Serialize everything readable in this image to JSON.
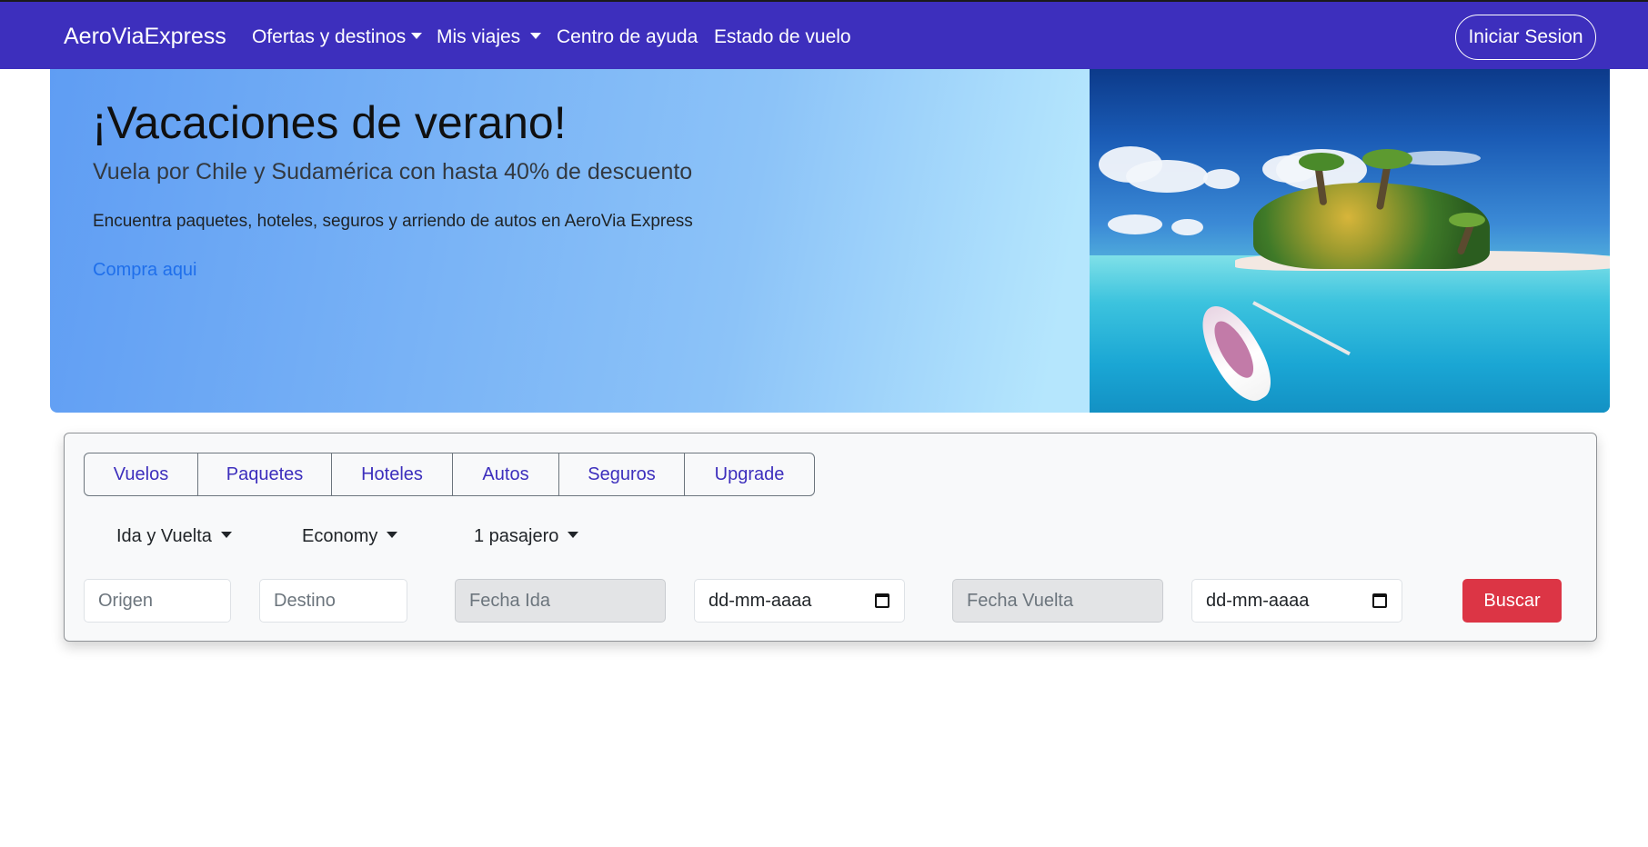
{
  "navbar": {
    "brand": "AeroViaExpress",
    "items": [
      {
        "label": "Ofertas y destinos",
        "dropdown": true
      },
      {
        "label": "Mis viajes",
        "dropdown": true
      },
      {
        "label": "Centro de ayuda",
        "dropdown": false
      },
      {
        "label": "Estado de vuelo",
        "dropdown": false
      }
    ],
    "login_label": "Iniciar Sesion",
    "background_color": "#3d2fbd"
  },
  "hero": {
    "title": "¡Vacaciones de verano!",
    "subtitle": "Vuela por Chile y Sudamérica con hasta 40% de descuento",
    "text": "Encuentra paquetes, hoteles, seguros y arriendo de autos en AeroVia Express",
    "link": "Compra aqui",
    "image": "tropical-island-beach-image"
  },
  "search": {
    "tabs": [
      "Vuelos",
      "Paquetes",
      "Hoteles",
      "Autos",
      "Seguros",
      "Upgrade"
    ],
    "trip_type": "Ida y Vuelta",
    "cabin_class": "Economy",
    "passengers": "1 pasajero",
    "origin_placeholder": "Origen",
    "destination_placeholder": "Destino",
    "departure_label": "Fecha Ida",
    "departure_date_placeholder": "dd-mm-aaaa",
    "return_label": "Fecha Vuelta",
    "return_date_placeholder": "dd-mm-aaaa",
    "submit_label": "Buscar",
    "submit_color": "#dc3545"
  }
}
